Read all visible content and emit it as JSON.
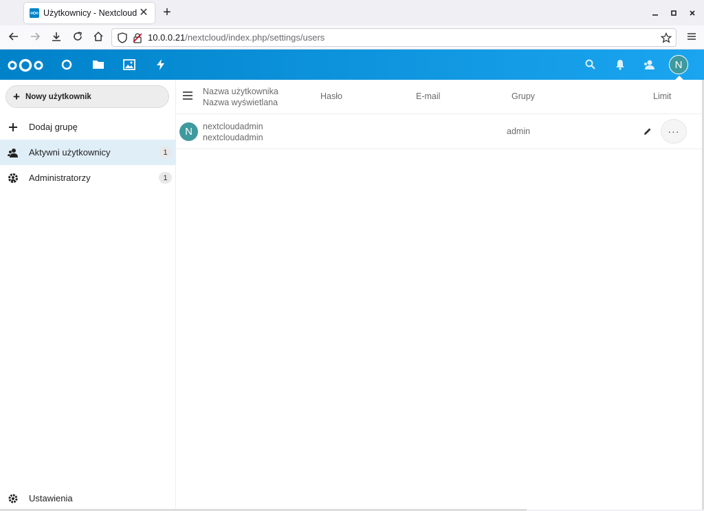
{
  "browser": {
    "tab_title": "Użytkownicy - Nextcloud",
    "url_host": "10.0.0.21",
    "url_path": "/nextcloud/index.php/settings/users",
    "new_tab_symbol": "+",
    "close_symbol": "✕"
  },
  "header": {
    "apps": [
      "dashboard-icon",
      "files-icon",
      "photos-icon",
      "activity-icon"
    ],
    "user_initial": "N",
    "brand_color": "#0082c9"
  },
  "sidebar": {
    "new_user_label": "Nowy użytkownik",
    "items": [
      {
        "label": "Dodaj grupę",
        "icon": "plus-icon"
      },
      {
        "label": "Aktywni użytkownicy",
        "icon": "users-icon",
        "count": "1"
      },
      {
        "label": "Administratorzy",
        "icon": "admin-icon",
        "count": "1"
      }
    ],
    "settings_label": "Ustawienia"
  },
  "table": {
    "headers": {
      "username": "Nazwa użytkownika",
      "displayname": "Nazwa wyświetlana",
      "password": "Hasło",
      "email": "E-mail",
      "groups": "Grupy",
      "quota": "Limit"
    },
    "rows": [
      {
        "initial": "N",
        "username": "nextcloudadmin",
        "displayname": "nextcloudadmin",
        "groups": "admin",
        "more": "···"
      }
    ]
  }
}
